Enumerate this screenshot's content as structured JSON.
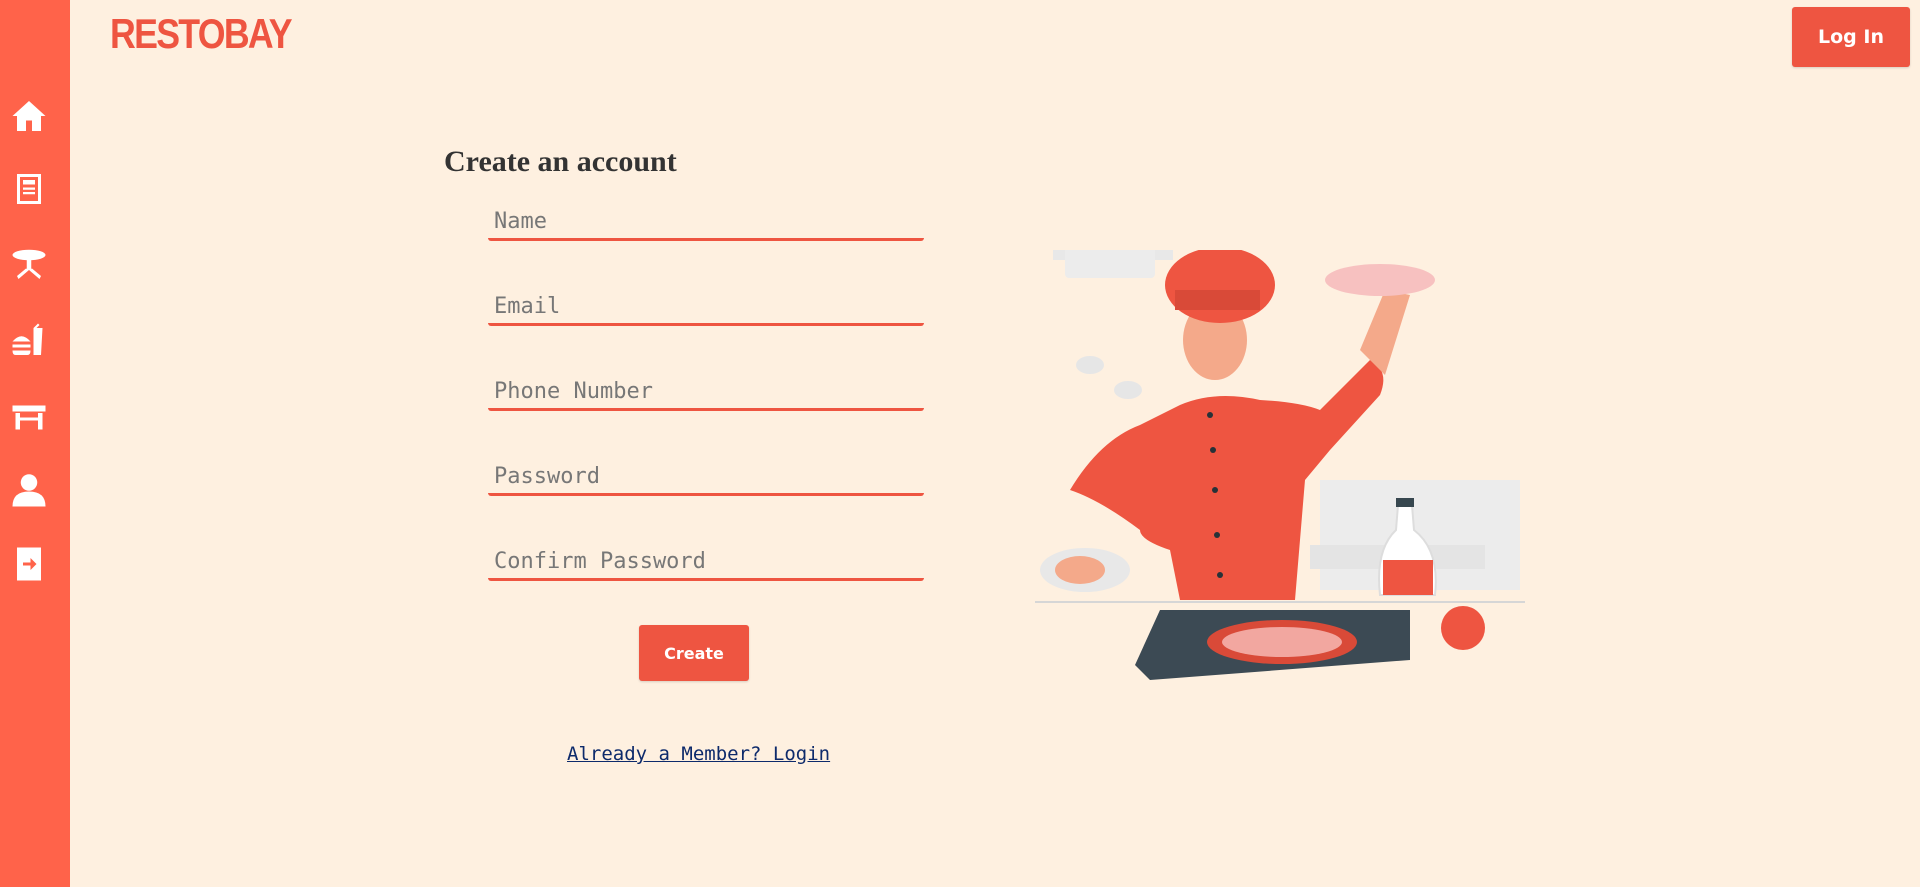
{
  "brand": {
    "logo": "RESTOBAY"
  },
  "header": {
    "login_label": "Log In"
  },
  "sidebar": {
    "items": [
      {
        "name": "home",
        "icon": "home-icon"
      },
      {
        "name": "menu",
        "icon": "book-icon"
      },
      {
        "name": "tables",
        "icon": "round-table-icon"
      },
      {
        "name": "food",
        "icon": "burger-drink-icon"
      },
      {
        "name": "booking",
        "icon": "table-icon"
      },
      {
        "name": "profile",
        "icon": "user-icon"
      },
      {
        "name": "logout",
        "icon": "sign-in-icon"
      }
    ]
  },
  "form": {
    "title": "Create an account",
    "fields": {
      "name": {
        "placeholder": "Name"
      },
      "email": {
        "placeholder": "Email"
      },
      "phone": {
        "placeholder": "Phone Number"
      },
      "password": {
        "placeholder": "Password"
      },
      "confirm": {
        "placeholder": "Confirm Password"
      }
    },
    "create_label": "Create",
    "member_link": "Already a Member? Login"
  },
  "illustration": {
    "subject": "chef-tossing-pizza-illustration"
  },
  "colors": {
    "accent": "#ee5541",
    "sidebar": "#ff634a",
    "background": "#fef0e0"
  }
}
